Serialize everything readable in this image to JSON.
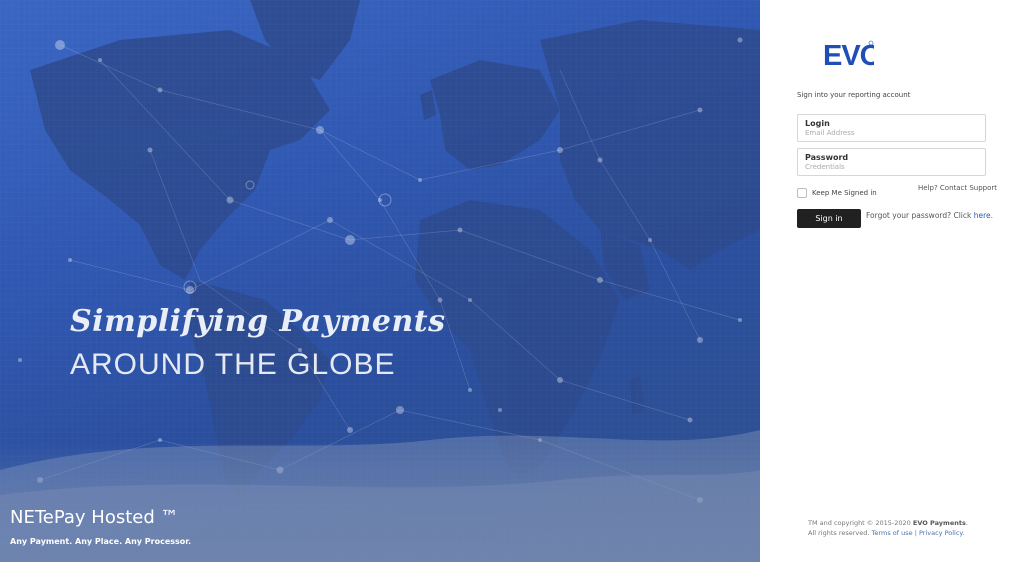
{
  "hero": {
    "tagline_script": "Simplifying Payments",
    "tagline_caps": "AROUND THE GLOBE",
    "product_name": "NETePay Hosted ™",
    "product_tag": "Any Payment. Any Place. Any Processor."
  },
  "brand": {
    "logo_text": "EVO",
    "logo_color": "#1f4fb6"
  },
  "form": {
    "heading": "Sign into your reporting account",
    "login_label": "Login",
    "login_placeholder": "Email Address",
    "login_value": "",
    "password_label": "Password",
    "password_placeholder": "Credentials",
    "password_value": "",
    "remember_label": "Keep Me Signed in",
    "remember_checked": false,
    "help_link": "Help? Contact Support",
    "signin_label": "Sign in",
    "forgot_text": "Forgot your password? Click",
    "forgot_link": "here."
  },
  "footer": {
    "prefix": "TM and copyright © 2015-2020",
    "company": "EVO Payments",
    "rights": ". All rights reserved.",
    "terms_link": "Terms of use",
    "separator": "|",
    "privacy_link": "Privacy Policy."
  }
}
